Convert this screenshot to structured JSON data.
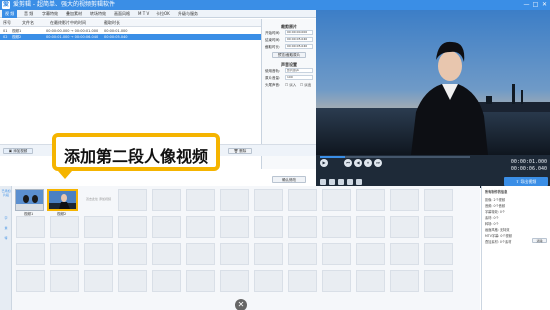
{
  "app": {
    "icon_text": "爱",
    "title": "爱剪辑 - 超简单、强大的视频剪辑软件"
  },
  "window_controls": [
    "—",
    "□",
    "✕"
  ],
  "menu": [
    "视 频",
    "音 频",
    "字幕特效",
    "叠加素材",
    "转场特效",
    "画面风格",
    "M T V",
    "卡拉OK",
    "升级与服务"
  ],
  "list": {
    "headers": [
      "序号",
      "文件名",
      "在最终影片中的时间",
      "截取时长"
    ],
    "rows": [
      {
        "num": "01",
        "name": "视频1",
        "time": "00:00:00.000 → 00:00:01.000",
        "dur": "00:00:01.000"
      },
      {
        "num": "02",
        "name": "视频2",
        "time": "00:00:01.000 → 00:00:06.040",
        "dur": "00:00:05.040"
      }
    ]
  },
  "props": {
    "trim_title": "裁剪原片",
    "trim": [
      {
        "label": "开始时间:",
        "value": "00:00:00.000"
      },
      {
        "label": "结束时间:",
        "value": "00:00:05.040"
      },
      {
        "label": "截取时长:",
        "value": "00:00:05.040"
      }
    ],
    "preview_btn": "预览/截取原片",
    "audio_title": "声音设置",
    "audio": [
      {
        "label": "使用音轨:",
        "value": "影片原声"
      },
      {
        "label": "原片音量:",
        "value": "100"
      }
    ],
    "headtail_label": "头尾声音:",
    "fade_in": "淡入",
    "fade_out": "淡出",
    "confirm_btn": "确认修改"
  },
  "toolbar": {
    "add_video": "添加视频",
    "delete": "删除"
  },
  "player": {
    "time_top": "00:00:01.000",
    "time_bottom": "00:00:06.040",
    "export_label": "导出视频",
    "buttons": [
      "⏮",
      "◀",
      "▶",
      "⏸",
      "⏭"
    ]
  },
  "timeline": {
    "tabs": [
      "已添加片段",
      "字",
      "素",
      "特"
    ],
    "clips": [
      {
        "label": "视频1",
        "duration": "1.0"
      },
      {
        "label": "视频2",
        "duration": "5.0"
      }
    ],
    "empty_hint": "双击此处\n添加视频"
  },
  "attributes": {
    "title": "所有制作的信息",
    "rows": [
      "影像: 2个视频",
      "音频: 0个音频",
      "字幕特效: 0个",
      "素材: 0个",
      "转场: 0个",
      "画面风格: 无特效",
      "MTV字幕: 0个视频",
      "叠加素材: 0个素材"
    ],
    "clear_btn": "清除"
  },
  "callout": {
    "text": "添加第二段人像视频"
  },
  "colors": {
    "accent": "#3a8ee6",
    "callout_border": "#f5b400"
  }
}
